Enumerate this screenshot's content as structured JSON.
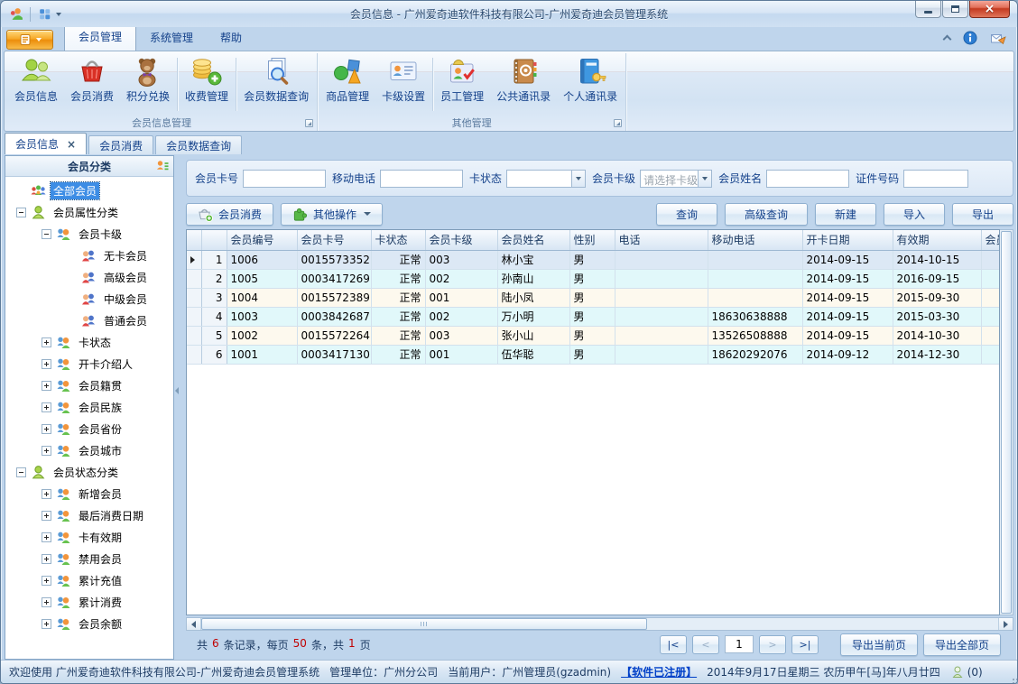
{
  "window": {
    "title": "会员信息 - 广州爱奇迪软件科技有限公司-广州爱奇迪会员管理系统"
  },
  "ribbon": {
    "tabs": [
      "会员管理",
      "系统管理",
      "帮助"
    ],
    "groups": [
      {
        "label": "会员信息管理",
        "buttons": [
          "会员信息",
          "会员消费",
          "积分兑换",
          "收费管理",
          "会员数据查询"
        ]
      },
      {
        "label": "其他管理",
        "buttons": [
          "商品管理",
          "卡级设置",
          "员工管理",
          "公共通讯录",
          "个人通讯录"
        ]
      }
    ]
  },
  "doc_tabs": [
    "会员信息",
    "会员消费",
    "会员数据查询"
  ],
  "sidebar": {
    "title": "会员分类",
    "tree": [
      {
        "label": "全部会员",
        "selected": true
      },
      {
        "label": "会员属性分类",
        "expander": "-"
      },
      {
        "label": "会员卡级",
        "expander": "-"
      },
      {
        "label": "无卡会员"
      },
      {
        "label": "高级会员"
      },
      {
        "label": "中级会员"
      },
      {
        "label": "普通会员"
      },
      {
        "label": "卡状态",
        "expander": "+"
      },
      {
        "label": "开卡介绍人",
        "expander": "+"
      },
      {
        "label": "会员籍贯",
        "expander": "+"
      },
      {
        "label": "会员民族",
        "expander": "+"
      },
      {
        "label": "会员省份",
        "expander": "+"
      },
      {
        "label": "会员城市",
        "expander": "+"
      },
      {
        "label": "会员状态分类",
        "expander": "-"
      },
      {
        "label": "新增会员",
        "expander": "+"
      },
      {
        "label": "最后消费日期",
        "expander": "+"
      },
      {
        "label": "卡有效期",
        "expander": "+"
      },
      {
        "label": "禁用会员",
        "expander": "+"
      },
      {
        "label": "累计充值",
        "expander": "+"
      },
      {
        "label": "累计消费",
        "expander": "+"
      },
      {
        "label": "会员余额",
        "expander": "+"
      }
    ]
  },
  "search": {
    "card_no_label": "会员卡号",
    "mobile_label": "移动电话",
    "card_status_label": "卡状态",
    "card_level_label": "会员卡级",
    "card_level_placeholder": "请选择卡级",
    "name_label": "会员姓名",
    "id_no_label": "证件号码"
  },
  "toolbar": {
    "consume": "会员消费",
    "other_ops": "其他操作",
    "query": "查询",
    "adv_query": "高级查询",
    "create": "新建",
    "import": "导入",
    "export": "导出"
  },
  "grid": {
    "columns": [
      "会员编号",
      "会员卡号",
      "卡状态",
      "会员卡级",
      "会员姓名",
      "性别",
      "电话",
      "移动电话",
      "开卡日期",
      "有效期",
      "会员"
    ],
    "rows": [
      {
        "num": "1",
        "cells": [
          "1006",
          "0015573352",
          "正常",
          "003",
          "林小宝",
          "男",
          "",
          "",
          "2014-09-15",
          "2014-10-15",
          ""
        ]
      },
      {
        "num": "2",
        "cells": [
          "1005",
          "0003417269",
          "正常",
          "002",
          "孙南山",
          "男",
          "",
          "",
          "2014-09-15",
          "2016-09-15",
          ""
        ]
      },
      {
        "num": "3",
        "cells": [
          "1004",
          "0015572389",
          "正常",
          "001",
          "陆小凤",
          "男",
          "",
          "",
          "2014-09-15",
          "2015-09-30",
          ""
        ]
      },
      {
        "num": "4",
        "cells": [
          "1003",
          "0003842687",
          "正常",
          "002",
          "万小明",
          "男",
          "",
          "18630638888",
          "2014-09-15",
          "2015-03-30",
          ""
        ]
      },
      {
        "num": "5",
        "cells": [
          "1002",
          "0015572264",
          "正常",
          "003",
          "张小山",
          "男",
          "",
          "13526508888",
          "2014-09-15",
          "2014-10-30",
          ""
        ]
      },
      {
        "num": "6",
        "cells": [
          "1001",
          "0003417130",
          "正常",
          "001",
          "伍华聪",
          "男",
          "",
          "18620292076",
          "2014-09-12",
          "2014-12-30",
          ""
        ]
      }
    ]
  },
  "pager": {
    "t1": "共",
    "records": "6",
    "t2": "条记录，每页",
    "per_page": "50",
    "t3": "条，共",
    "pages": "1",
    "t4": "页",
    "first": "|<",
    "prev": "<",
    "page": "1",
    "next": ">",
    "last": ">|",
    "export_current": "导出当前页",
    "export_all": "导出全部页"
  },
  "statusbar": {
    "welcome": "欢迎使用 广州爱奇迪软件科技有限公司-广州爱奇迪会员管理系统",
    "org_label": "管理单位：",
    "org": "广州分公司",
    "user_label": "当前用户：",
    "user": "广州管理员(gzadmin)",
    "registered": "【软件已注册】",
    "date": "2014年9月17日星期三 农历甲午[马]年八月廿四",
    "online": "(0)"
  }
}
